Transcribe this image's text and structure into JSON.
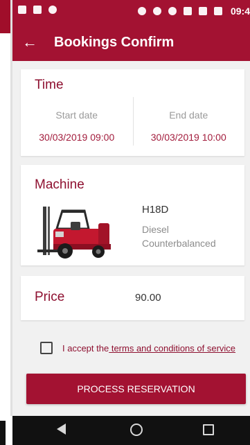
{
  "status_bar": {
    "time": "09:4"
  },
  "app_bar": {
    "title": "Bookings Confirm"
  },
  "time_section": {
    "title": "Time",
    "start_label": "Start date",
    "start_value": "30/03/2019 09:00",
    "end_label": "End date",
    "end_value": "30/03/2019 10:00"
  },
  "machine_section": {
    "title": "Machine",
    "model": "H18D",
    "fuel": "Diesel",
    "type": "Counterbalanced"
  },
  "price_section": {
    "label": "Price",
    "value": "90.00"
  },
  "terms": {
    "prefix": "I accept the",
    "link_text": " terms and conditions of service",
    "checked": false
  },
  "actions": {
    "process_label": "PROCESS RESERVATION"
  },
  "colors": {
    "primary": "#a31232",
    "accent_text": "#8e1030"
  },
  "icons": {
    "back": "arrow-back",
    "nav_back": "triangle-left",
    "nav_home": "circle",
    "nav_recent": "square"
  }
}
